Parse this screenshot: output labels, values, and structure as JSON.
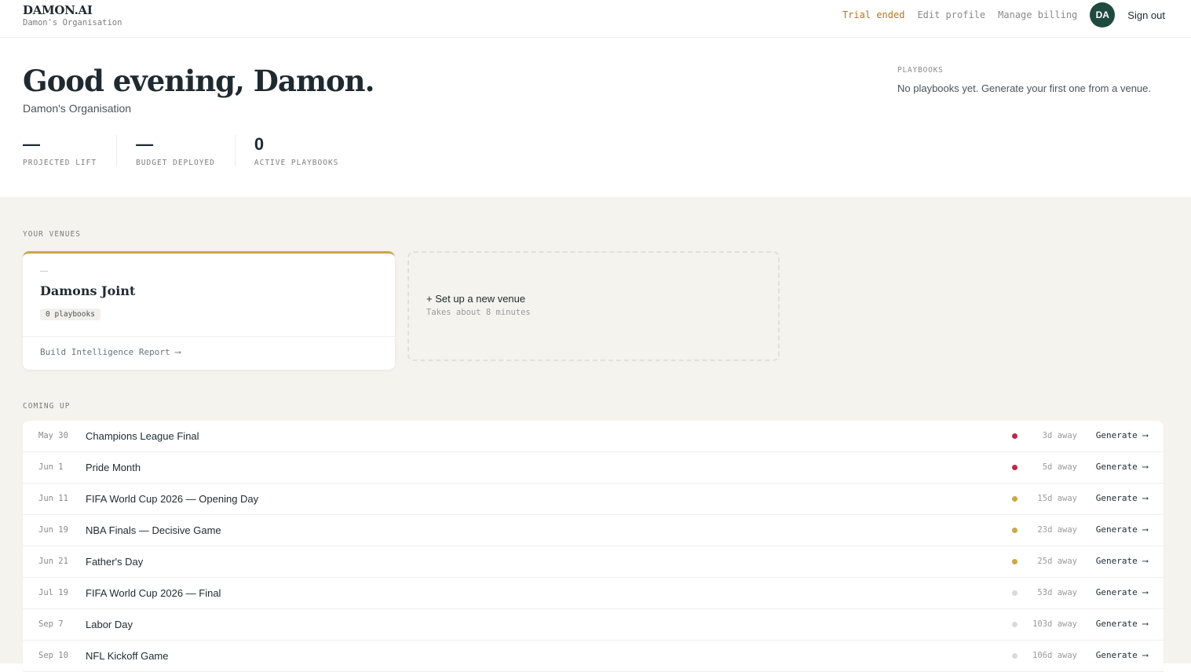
{
  "header": {
    "brand": "DAMON.AI",
    "org": "Damon's Organisation",
    "trial_label": "Trial ended",
    "edit_profile": "Edit profile",
    "manage_billing": "Manage billing",
    "avatar_initials": "DA",
    "sign_out": "Sign out"
  },
  "hero": {
    "greeting": "Good evening, Damon.",
    "org": "Damon's Organisation",
    "stats": [
      {
        "value": "—",
        "label": "PROJECTED LIFT"
      },
      {
        "value": "—",
        "label": "BUDGET DEPLOYED"
      },
      {
        "value": "0",
        "label": "ACTIVE PLAYBOOKS"
      }
    ],
    "playbooks_label": "PLAYBOOKS",
    "playbooks_text": "No playbooks yet. Generate your first one from a venue."
  },
  "venues": {
    "section_label": "YOUR VENUES",
    "card": {
      "dash": "—",
      "name": "Damons Joint",
      "badge": "0 playbooks",
      "link": "Build Intelligence Report ⟶"
    },
    "new_venue": {
      "title": "+ Set up a new venue",
      "subtitle": "Takes about 8 minutes"
    }
  },
  "coming_up": {
    "section_label": "COMING UP",
    "generate_label": "Generate ⟶",
    "events": [
      {
        "date": "May 30",
        "name": "Champions League Final",
        "away": "3d away",
        "dot": "#c2274a"
      },
      {
        "date": "Jun 1",
        "name": "Pride Month",
        "away": "5d away",
        "dot": "#c2274a"
      },
      {
        "date": "Jun 11",
        "name": "FIFA World Cup 2026 — Opening Day",
        "away": "15d away",
        "dot": "#c9a846"
      },
      {
        "date": "Jun 19",
        "name": "NBA Finals — Decisive Game",
        "away": "23d away",
        "dot": "#c9a846"
      },
      {
        "date": "Jun 21",
        "name": "Father's Day",
        "away": "25d away",
        "dot": "#c9a846"
      },
      {
        "date": "Jul 19",
        "name": "FIFA World Cup 2026 — Final",
        "away": "53d away",
        "dot": "#d9d9d9"
      },
      {
        "date": "Sep 7",
        "name": "Labor Day",
        "away": "103d away",
        "dot": "#d9d9d9"
      },
      {
        "date": "Sep 10",
        "name": "NFL Kickoff Game",
        "away": "106d away",
        "dot": "#d9d9d9"
      }
    ]
  }
}
